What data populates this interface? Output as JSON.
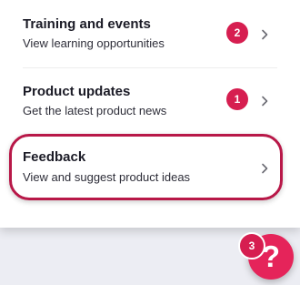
{
  "menu": {
    "items": [
      {
        "title": "Training and events",
        "subtitle": "View learning opportunities",
        "badge": "2",
        "icon": "chevron-right-icon"
      },
      {
        "title": "Product updates",
        "subtitle": "Get the latest product news",
        "badge": "1",
        "icon": "chevron-right-icon"
      },
      {
        "title": "Feedback",
        "subtitle": "View and suggest product ideas",
        "badge": null,
        "icon": "chevron-right-icon",
        "highlighted": true
      }
    ]
  },
  "help_button": {
    "glyph": "?",
    "badge": "3",
    "icon": "question-mark-icon"
  },
  "colors": {
    "accent": "#e5245a",
    "badge": "#d61e50",
    "highlight_outline": "#b81848",
    "background": "#ecedf3"
  }
}
